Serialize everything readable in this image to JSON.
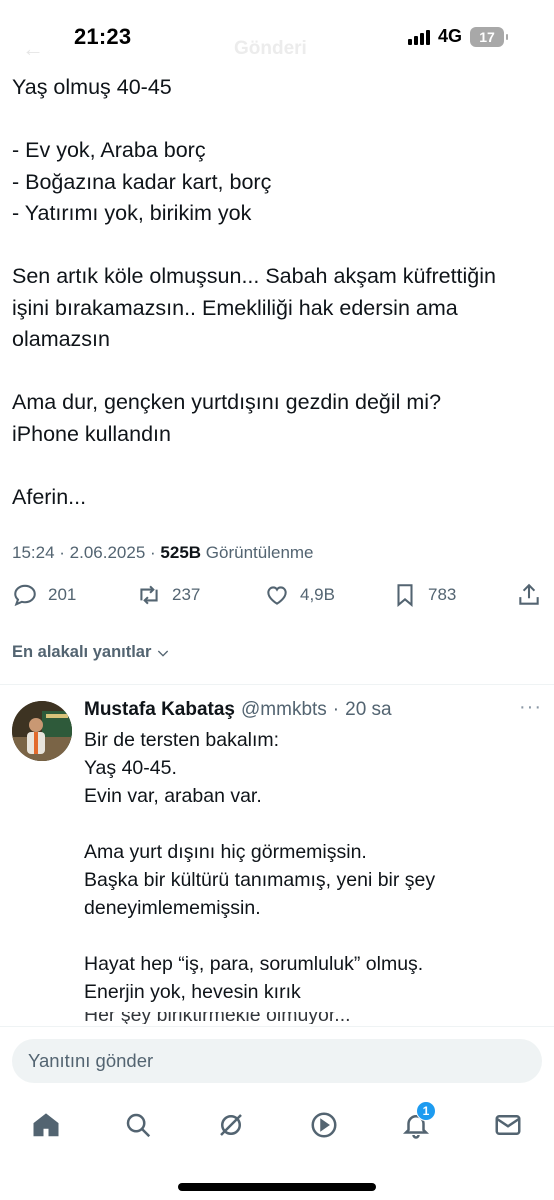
{
  "status_bar": {
    "time": "21:23",
    "network": "4G",
    "battery": "17"
  },
  "header": {
    "back_icon": "arrow-left-icon",
    "title": "Gönderi"
  },
  "tweet": {
    "lines": [
      "Yaş olmuş 40-45",
      "",
      "- Ev yok, Araba borç",
      "- Boğazına kadar kart, borç",
      "- Yatırımı yok, birikim yok",
      "",
      "Sen artık köle olmuşsun... Sabah akşam küfrettiğin",
      "işini bırakamazsın.. Emekliliği hak edersin ama",
      "olamazsın",
      "",
      "Ama dur, gençken yurtdışını gezdin değil mi?",
      "iPhone kullandın",
      "",
      "Aferin..."
    ],
    "time": "15:24",
    "date": "2.06.2025",
    "views": "525B",
    "views_label": "Görüntülenme"
  },
  "actions": {
    "replies": "201",
    "reposts": "237",
    "likes": "4,9B",
    "bookmarks": "783"
  },
  "sort_label": "En alakalı yanıtlar",
  "reply": {
    "name": "Mustafa Kabataş",
    "handle": "@mmkbts",
    "age": "20 sa",
    "lines": [
      "Bir de tersten bakalım:",
      "Yaş 40-45.",
      "Evin var, araban var.",
      "",
      "Ama yurt dışını hiç görmemişsin.",
      "Başka bir kültürü tanımamış, yeni bir şey",
      "deneyimlememişsin.",
      "",
      "Hayat hep “iş, para, sorumluluk” olmuş.",
      "Enerjin yok, hevesin kırık",
      "",
      "Her şey biriktirmekle olmuyor..."
    ]
  },
  "compose": {
    "placeholder": "Yanıtını gönder"
  },
  "tabbar": {
    "items": [
      "home-icon",
      "search-icon",
      "grok-icon",
      "video-icon",
      "bell-icon",
      "mail-icon"
    ],
    "notification_count": "1"
  },
  "colors": {
    "accent": "#1d9bf0",
    "text": "#0f1419",
    "muted": "#536471"
  }
}
